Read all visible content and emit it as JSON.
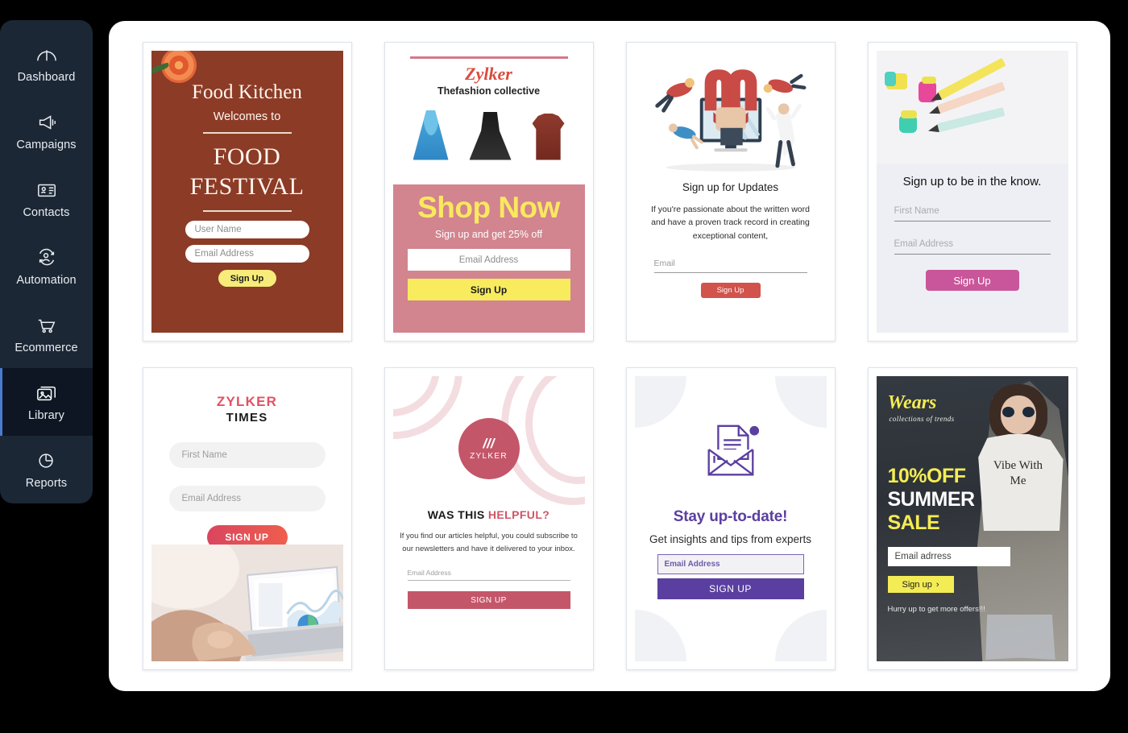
{
  "sidebar": {
    "items": [
      {
        "label": "Dashboard",
        "icon": "dashboard-gauge-icon",
        "active": false
      },
      {
        "label": "Campaigns",
        "icon": "megaphone-icon",
        "active": false
      },
      {
        "label": "Contacts",
        "icon": "contact-card-icon",
        "active": false
      },
      {
        "label": "Automation",
        "icon": "automation-users-icon",
        "active": false
      },
      {
        "label": "Ecommerce",
        "icon": "shopping-cart-icon",
        "active": false
      },
      {
        "label": "Library",
        "icon": "images-icon",
        "active": true
      },
      {
        "label": "Reports",
        "icon": "pie-chart-icon",
        "active": false
      }
    ],
    "background": "#1b2735",
    "active_background": "#0d1622",
    "accent": "#4a7bd1"
  },
  "templates": [
    {
      "id": "food-festival",
      "name": "food-festival-template",
      "brand": "Food Kitchen",
      "welcome": "Welcomes to",
      "headline_line1": "FOOD",
      "headline_line2": "FESTIVAL",
      "fields": [
        {
          "placeholder": "User Name"
        },
        {
          "placeholder": "Email Address"
        }
      ],
      "button": "Sign Up",
      "colors": {
        "background": "#8c3b26",
        "button": "#f7ec7a"
      }
    },
    {
      "id": "zylker-shop",
      "name": "zylker-fashion-template",
      "logo": "Zylker",
      "tagline": "Thefashion collective",
      "headline": "Shop Now",
      "subline": "Sign up and get 25% off",
      "fields": [
        {
          "placeholder": "Email Address"
        }
      ],
      "button": "Sign Up",
      "colors": {
        "panel": "#d2848f",
        "headline": "#fae85f",
        "button": "#f8ec5e"
      }
    },
    {
      "id": "sign-up-updates",
      "name": "magnet-updates-template",
      "headline": "Sign up for Updates",
      "body": "If you're passionate about the written word and have a proven track record in creating exceptional content,",
      "fields": [
        {
          "placeholder": "Email"
        }
      ],
      "button": "Sign Up",
      "colors": {
        "button": "#d1534b"
      }
    },
    {
      "id": "in-the-know",
      "name": "stationery-know-template",
      "headline": "Sign up to be in the know.",
      "fields": [
        {
          "placeholder": "First Name"
        },
        {
          "placeholder": "Email Address"
        }
      ],
      "button": "Sign Up",
      "colors": {
        "background": "#eeeff5",
        "button": "#c9569a"
      }
    },
    {
      "id": "zylker-times",
      "name": "zylker-times-template",
      "logo_top": "ZYLKER",
      "logo_bottom": "TIMES",
      "fields": [
        {
          "placeholder": "First Name"
        },
        {
          "placeholder": "Email Address"
        }
      ],
      "button": "SIGN UP",
      "colors": {
        "logo": "#e35163",
        "button": "#e0504f"
      }
    },
    {
      "id": "was-this-helpful",
      "name": "was-this-helpful-template",
      "logo_brand": "ZYLKER",
      "headline_plain": "WAS THIS ",
      "headline_accent": "HELPFUL?",
      "body": "If you find our articles helpful, you could subscribe to our newsletters and have it delivered to your inbox.",
      "fields": [
        {
          "placeholder": "Email Address"
        }
      ],
      "button": "SIGN UP",
      "colors": {
        "brand": "#c4566a",
        "accent": "#d05565"
      }
    },
    {
      "id": "stay-up-to-date",
      "name": "stay-up-to-date-template",
      "headline": "Stay up-to-date!",
      "subline": "Get insights and tips from experts",
      "fields": [
        {
          "placeholder": "Email Address"
        }
      ],
      "button": "SIGN UP",
      "colors": {
        "primary": "#5b3fa0",
        "corner": "#f1f2f6"
      }
    },
    {
      "id": "wears-summer-sale",
      "name": "wears-summer-sale-template",
      "brand": "Wears",
      "brand_sub": "collections of trends",
      "offer": "10%OFF",
      "line2": "SUMMER",
      "line3": "SALE",
      "shirt_print": "Vibe With Me",
      "fields": [
        {
          "placeholder": "Email adrress"
        }
      ],
      "button": "Sign up",
      "button_arrow": "›",
      "note": "Hurry up to get more offers!!!",
      "colors": {
        "accent": "#f4ec54",
        "background": "#2b3036"
      }
    }
  ]
}
